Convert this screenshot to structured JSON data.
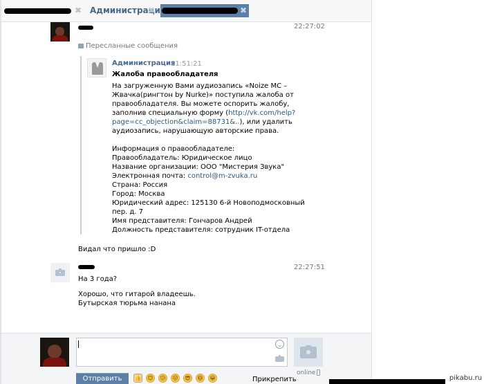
{
  "tabs": [
    {
      "label": "Администрация",
      "close": "✖",
      "active": false
    },
    {
      "label": "",
      "close": "✖",
      "active": true
    }
  ],
  "messages": [
    {
      "time": "22:27:02",
      "forwarded_label": "Пересланные сообщения",
      "quote": {
        "author": "Администрация",
        "time": "11:51:21",
        "title": "Жалоба правообладателя",
        "body": [
          {
            "text": "На загруженную Вами аудиозапись «Noize MC –"
          },
          {
            "text": "Жвачка(рингтон by Nurke)» поступила жалоба от"
          },
          {
            "text": "правообладателя. Вы можете оспорить жалобу,"
          },
          {
            "text": "заполнив специальную форму (",
            "link": "http://vk.com/help?"
          },
          {
            "link": "page=cc_objection&claim=88731&..",
            "text_after": "), или удалить"
          },
          {
            "text": "аудиозапись, нарушающую авторские права."
          }
        ],
        "info_header": "Информация о правообладателе:",
        "info": [
          {
            "text": "Правообладатель: Юридическое лицо"
          },
          {
            "text": "Название организации: ООО \"Мистерия Звука\""
          },
          {
            "text": "Электронная почта: ",
            "link": "control@m-zvuka.ru"
          },
          {
            "text": "Страна: Россия"
          },
          {
            "text": "Город: Москва"
          },
          {
            "text": "Юридический адрес: 125130 6-й Новоподмосковный"
          },
          {
            "text": "пер. д. 7"
          },
          {
            "text": "Имя представителя: Гончаров Андрей"
          },
          {
            "text": "Должность представителя: сотрудник IT-отдела"
          }
        ]
      },
      "text": "Видал что пришло :D"
    },
    {
      "time": "22:27:51",
      "lines": [
        "На 3 года?",
        "",
        "Хорошо, что гитарой владеешь.",
        "Бутырская тюрьма нанана"
      ]
    }
  ],
  "composer": {
    "send_label": "Отправить",
    "attach_label": "Прикрепить",
    "status": "online",
    "emoji": [
      "👍",
      "😊",
      "😕",
      "😛",
      "😎",
      "😄",
      "😀"
    ]
  },
  "watermark": "pikabu.ru",
  "colors": {
    "accent": "#5b7fa6",
    "link": "#2b587a",
    "name": "#45688e"
  }
}
